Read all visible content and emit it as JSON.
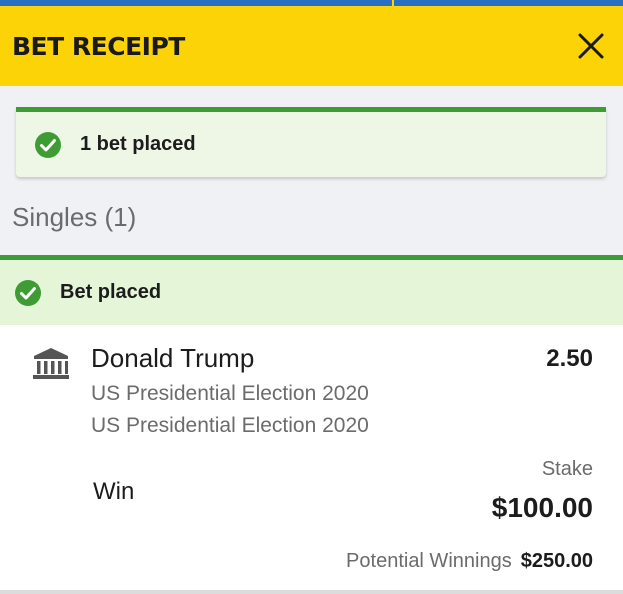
{
  "header": {
    "title": "BET RECEIPT",
    "close_icon": "close-icon"
  },
  "summary": {
    "text": "1 bet placed",
    "icon": "check-circle-icon"
  },
  "section": {
    "title": "Singles (1)"
  },
  "bet": {
    "status_text": "Bet placed",
    "market_icon": "bank-building-icon",
    "selection": "Donald Trump",
    "odds": "2.50",
    "event_lines": [
      "US Presidential Election 2020",
      "US Presidential Election 2020"
    ],
    "bet_type": "Win",
    "stake_label": "Stake",
    "stake_value": "$100.00",
    "potential_winnings_label": "Potential Winnings",
    "potential_winnings_value": "$250.00"
  },
  "colors": {
    "header_bg": "#fbd307",
    "success_green": "#3f9b34",
    "success_bg": "#e4f5d8",
    "page_bg": "#eff1f4",
    "top_strip": "#2b6fc2"
  }
}
